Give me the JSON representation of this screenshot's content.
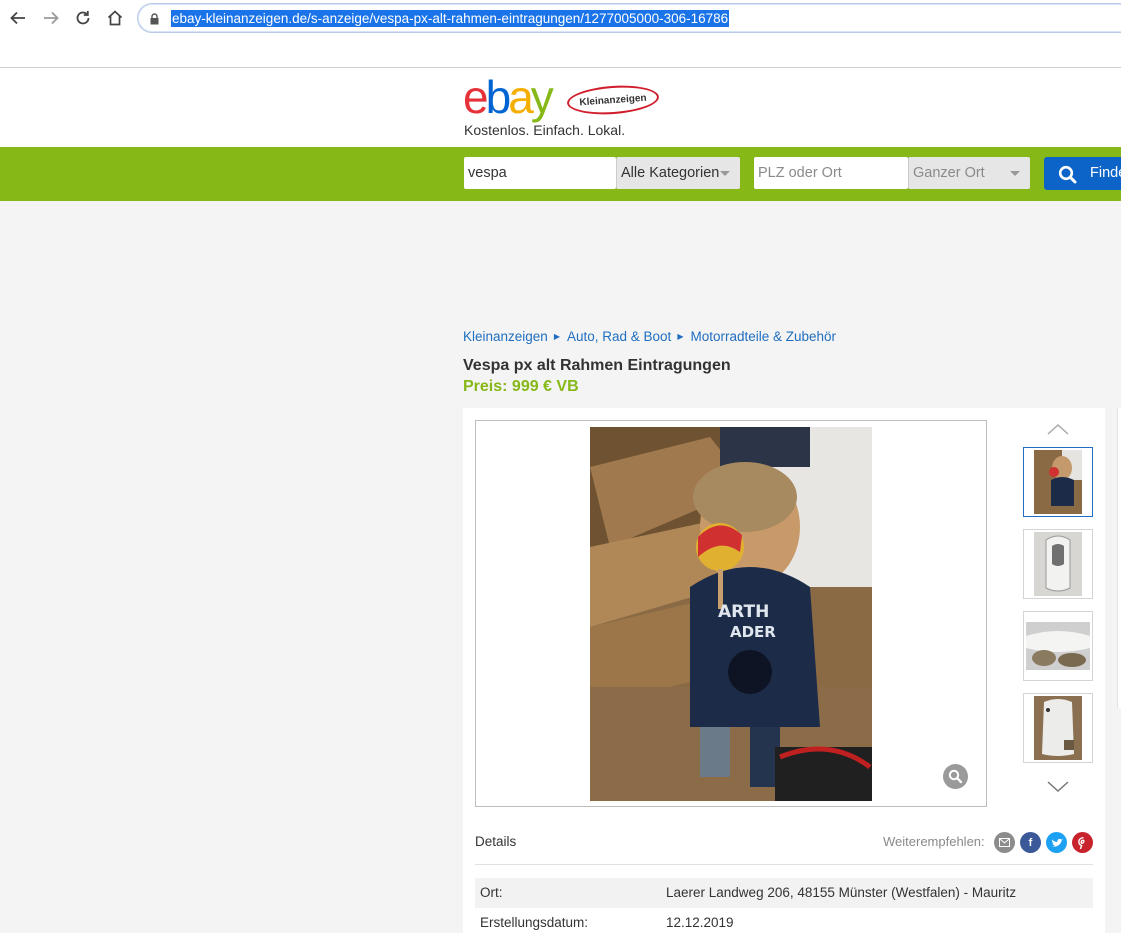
{
  "browser": {
    "url": "ebay-kleinanzeigen.de/s-anzeige/vespa-px-alt-rahmen-eintragungen/1277005000-306-16786",
    "icons": [
      "back-icon",
      "forward-icon",
      "reload-icon",
      "home-icon",
      "lock-icon"
    ]
  },
  "header": {
    "logo_letters": [
      "e",
      "b",
      "a",
      "y"
    ],
    "logo_colors": [
      "#e53238",
      "#0064d2",
      "#f5af02",
      "#86b817"
    ],
    "badge": "Kleinanzeigen",
    "tagline": "Kostenlos. Einfach. Lokal."
  },
  "search": {
    "query": "vespa",
    "category": "Alle Kategorien",
    "location_placeholder": "PLZ oder Ort",
    "radius": "Ganzer Ort",
    "button_label": "Finden"
  },
  "breadcrumb": [
    "Kleinanzeigen",
    "Auto, Rad & Boot",
    "Motorradteile & Zubehör"
  ],
  "listing": {
    "title": "Vespa px alt Rahmen Eintragungen",
    "price": "Preis: 999 € VB"
  },
  "gallery": {
    "thumbnail_count": 4,
    "active_index": 0
  },
  "details": {
    "label": "Details",
    "share_label": "Weiterempfehlen:",
    "share_icons": [
      "email-icon",
      "facebook-icon",
      "twitter-icon",
      "pinterest-icon"
    ],
    "rows": [
      {
        "key": "Ort:",
        "value": "Laerer Landweg 206, 48155 Münster (Westfalen) - Mauritz"
      },
      {
        "key": "Erstellungsdatum:",
        "value": "12.12.2019"
      }
    ]
  },
  "colors": {
    "green": "#86b817",
    "link_blue": "#1f6ec0",
    "button_blue": "#0d64c8"
  }
}
